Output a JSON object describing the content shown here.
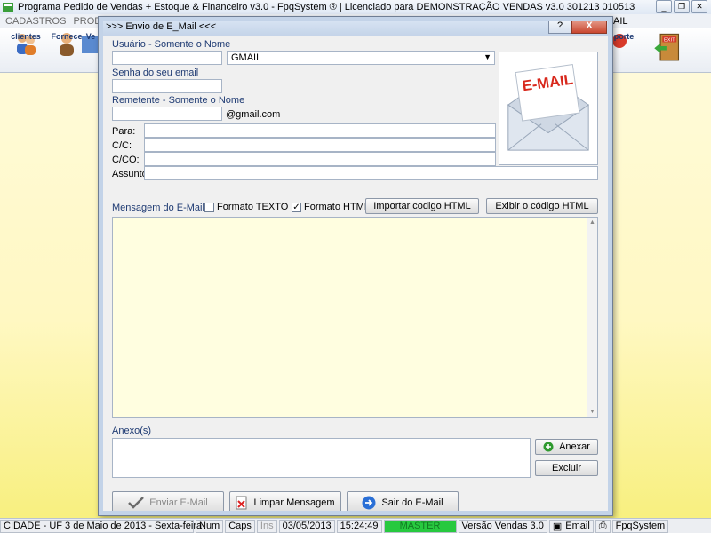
{
  "app": {
    "title": "Programa Pedido de Vendas + Estoque & Financeiro v3.0 - FpqSystem ® | Licenciado para  DEMONSTRAÇÃO VENDAS v3.0 301213 010513",
    "menu": [
      "CADASTROS",
      "PRODUTO"
    ],
    "menu_right": "AIL",
    "toolbar": [
      {
        "label": "clientes",
        "icon": "clients-icon"
      },
      {
        "label": "Fornece",
        "icon": "supplier-icon"
      },
      {
        "label": "Ve",
        "icon": "sales-icon"
      },
      {
        "label": "porte",
        "icon": "support-icon"
      },
      {
        "label": "",
        "icon": "exit-icon"
      }
    ],
    "toolbar_exit_text": "EXIT"
  },
  "dialog": {
    "title": ">>> Envio de E_Mail <<<",
    "close_label": "X",
    "user_label": "Usuário - Somente o Nome",
    "user_value": "",
    "provider_value": "GMAIL",
    "password_label": "Senha do seu email",
    "sender_label": "Remetente - Somente o Nome",
    "sender_domain": "@gmail.com",
    "to_label": "Para:",
    "cc_label": "C/C:",
    "bcc_label": "C/CO:",
    "subject_label": "Assunto:",
    "message_label": "Mensagem do E-Mail",
    "format_text_label": "Formato TEXTO",
    "format_text_checked": false,
    "format_html_label": "Formato HTML",
    "format_html_checked": true,
    "import_html_button": "Importar codigo HTML",
    "show_html_button": "Exibir o código HTML",
    "attachments_label": "Anexo(s)",
    "attach_button": "Anexar",
    "remove_button": "Excluir",
    "send_button": "Enviar E-Mail",
    "clear_button": "Limpar Mensagem",
    "exit_button": "Sair do E-Mail",
    "email_image_text": "E-MAIL"
  },
  "status": {
    "city": "CIDADE - UF  3 de Maio de 2013 - Sexta-feira",
    "num": "Num",
    "caps": "Caps",
    "ins": "Ins",
    "date": "03/05/2013",
    "time": "15:24:49",
    "user": "MASTER",
    "version": "Versão Vendas 3.0",
    "email": "Email",
    "brand": "FpqSystem"
  },
  "colors": {
    "accent_blue": "#1f3b73",
    "close_red": "#c9462f",
    "status_green": "#27c93f",
    "editor_bg": "#fffee0"
  }
}
